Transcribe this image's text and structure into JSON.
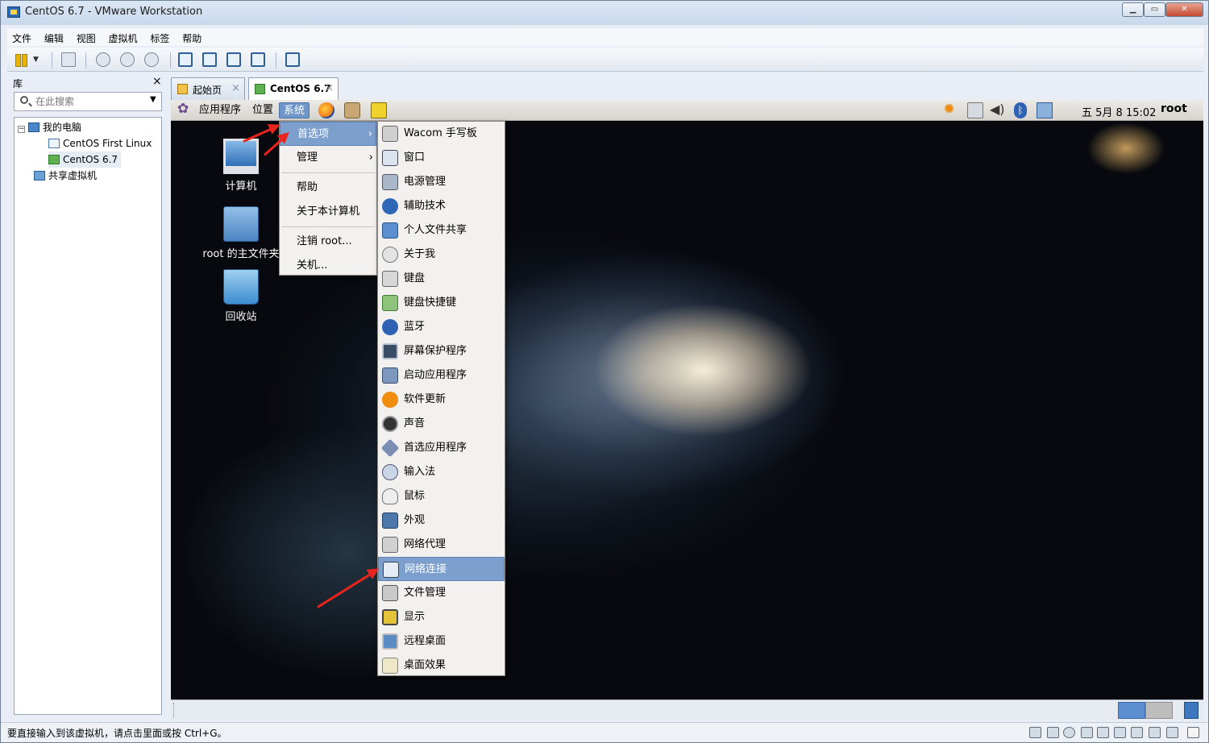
{
  "window": {
    "title": "CentOS 6.7 - VMware Workstation"
  },
  "menubar": {
    "items": [
      "文件",
      "编辑",
      "视图",
      "虚拟机",
      "标签",
      "帮助"
    ]
  },
  "library": {
    "title": "库",
    "close": "×",
    "search_placeholder": "在此搜索",
    "tree": {
      "root": "我的电脑",
      "vms": [
        "CentOS First Linux",
        "CentOS 6.7"
      ],
      "shared": "共享虚拟机"
    }
  },
  "tabs": [
    {
      "label": "起始页",
      "close": "×"
    },
    {
      "label": "CentOS 6.7",
      "close": "×"
    }
  ],
  "gnome_panel": {
    "menus": [
      "应用程序",
      "位置",
      "系统"
    ],
    "clock": "五 5月  8 15:02",
    "user": "root"
  },
  "desktop_icons": [
    "计算机",
    "root 的主文件夹",
    "回收站"
  ],
  "system_menu": {
    "items": [
      "首选项",
      "管理",
      "帮助",
      "关于本计算机",
      "注销 root...",
      "关机..."
    ]
  },
  "preferences_submenu": {
    "items": [
      "Wacom 手写板",
      "窗口",
      "电源管理",
      "辅助技术",
      "个人文件共享",
      "关于我",
      "键盘",
      "键盘快捷键",
      "蓝牙",
      "屏幕保护程序",
      "启动应用程序",
      "软件更新",
      "声音",
      "首选应用程序",
      "输入法",
      "鼠标",
      "外观",
      "网络代理",
      "网络连接",
      "文件管理",
      "显示",
      "远程桌面",
      "桌面效果"
    ],
    "highlighted": "网络连接"
  },
  "statusbar": {
    "text": "要直接输入到该虚拟机，请点击里面或按 Ctrl+G。"
  },
  "colors": {
    "highlight": "#7c9fce",
    "arrow": "#e8241c"
  }
}
